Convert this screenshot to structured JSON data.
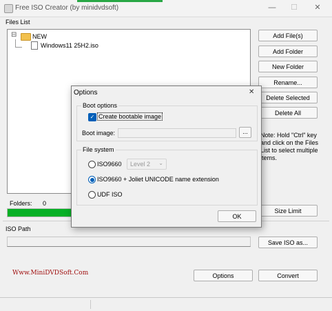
{
  "window": {
    "title": "Free ISO Creator (by minidvdsoft)",
    "close_glyph": "✕",
    "min_glyph": "—",
    "max_glyph": "☐"
  },
  "files_list": {
    "label": "Files List",
    "root_folder": "NEW",
    "tree_toggle": "⊟",
    "file": "Windows11 25H2.iso"
  },
  "side_buttons": [
    "Add File(s)",
    "Add Folder",
    "New Folder",
    "Rename...",
    "Delete Selected",
    "Delete All"
  ],
  "note": "Note: Hold \"Ctrl\" key and click on the Files List to select multiple items.",
  "folders": {
    "label": "Folders:",
    "value": "0"
  },
  "size_limit_label": "Size Limit",
  "iso_path": {
    "label": "ISO Path",
    "value": ""
  },
  "save_iso_label": "Save ISO as...",
  "website": "Www.MiniDVDSoft.Com",
  "options_label": "Options",
  "convert_label": "Convert",
  "dialog": {
    "title": "Options",
    "close_glyph": "✕",
    "boot_group": "Boot options",
    "create_bootable": "Create bootable image",
    "create_bootable_checked": true,
    "boot_image_label": "Boot image:",
    "boot_image_value": "",
    "browse_label": "...",
    "fs_group": "File system",
    "fs_options": [
      "ISO9660",
      "ISO9660 + Joliet UNICODE name extension",
      "UDF ISO"
    ],
    "fs_selected": "ISO9660 + Joliet UNICODE name extension",
    "level_value": "Level 2",
    "ok_label": "OK"
  },
  "colors": {
    "progress_green": "#06b025",
    "accent_blue": "#005fb8",
    "website_red": "#a01010"
  }
}
